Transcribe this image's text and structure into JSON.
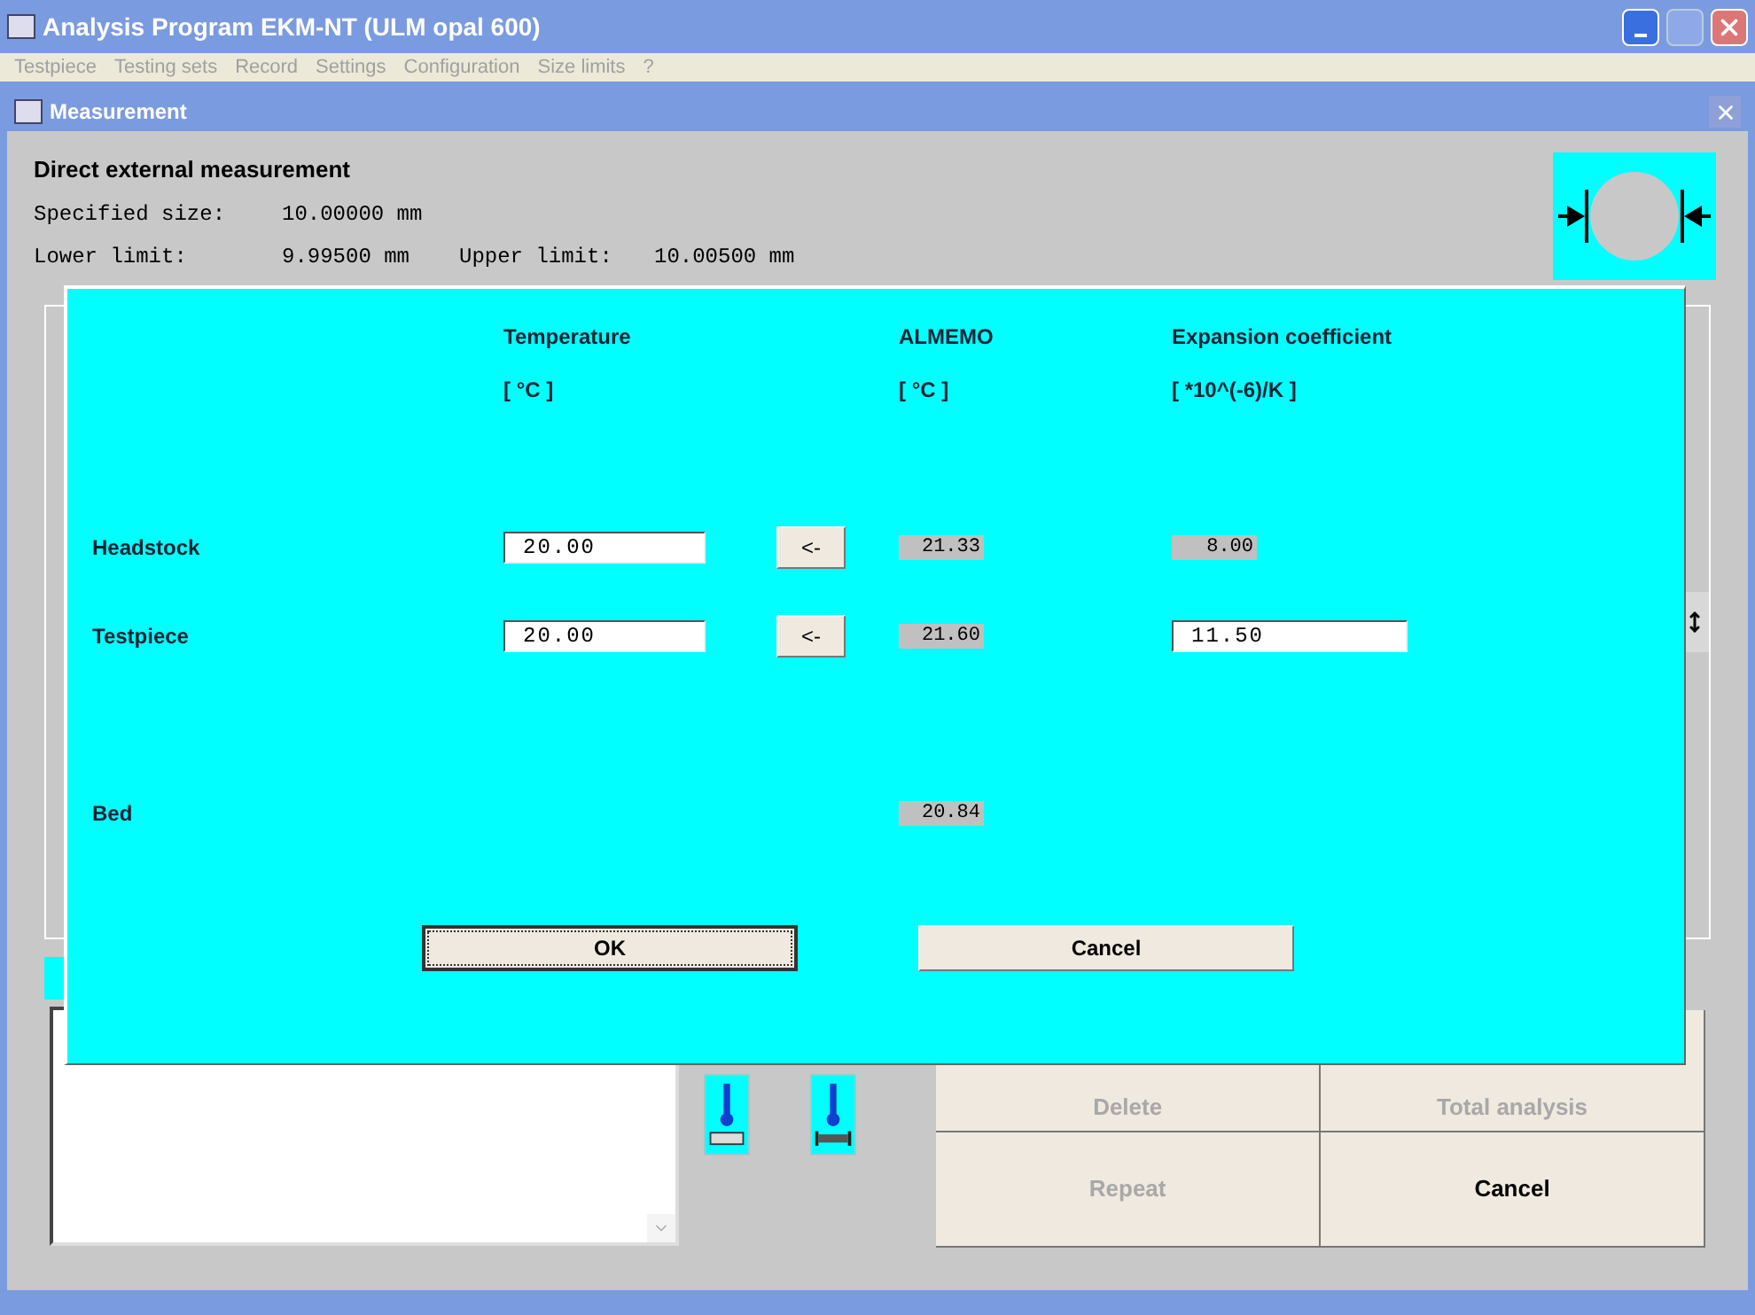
{
  "window": {
    "title": "Analysis Program  EKM-NT  (ULM opal 600)"
  },
  "menu": [
    {
      "label": "Testpiece",
      "disabled": true
    },
    {
      "label": "Testing sets",
      "disabled": true
    },
    {
      "label": "Record",
      "disabled": true
    },
    {
      "label": "Settings",
      "disabled": true
    },
    {
      "label": "Configuration",
      "disabled": true
    },
    {
      "label": "Size limits",
      "disabled": true
    },
    {
      "label": "?",
      "disabled": true
    }
  ],
  "child_window": {
    "title": "Measurement"
  },
  "measurement": {
    "heading": "Direct external measurement",
    "specified_size_label": "Specified size:",
    "specified_size": "10.00000 mm",
    "lower_limit_label": "Lower limit:",
    "lower_limit": "9.99500 mm",
    "upper_limit_label": "Upper limit:",
    "upper_limit": "10.00500 mm"
  },
  "dialog": {
    "columns": [
      {
        "title": "Temperature",
        "unit": "[ °C ]"
      },
      {
        "title": "ALMEMO",
        "unit": "[ °C ]"
      },
      {
        "title": "Expansion coefficient",
        "unit": "[ *10^(-6)/K ]"
      }
    ],
    "rows": [
      {
        "label": "Headstock",
        "temperature": "20.00",
        "copy_button": "<-",
        "almemo": "21.33",
        "coefficient": "8.00",
        "coefficient_editable": false
      },
      {
        "label": "Testpiece",
        "temperature": "20.00",
        "copy_button": "<-",
        "almemo": "21.60",
        "coefficient": "11.50",
        "coefficient_editable": true
      },
      {
        "label": "Bed",
        "almemo": "20.84"
      }
    ],
    "buttons": [
      {
        "label": "OK",
        "focused": true
      },
      {
        "label": "Cancel",
        "focused": false
      }
    ]
  },
  "actions": [
    {
      "label": "Delete",
      "disabled": true
    },
    {
      "label": "Total analysis",
      "disabled": true
    },
    {
      "label": "Repeat",
      "disabled": true
    },
    {
      "label": "Cancel",
      "disabled": false
    }
  ]
}
